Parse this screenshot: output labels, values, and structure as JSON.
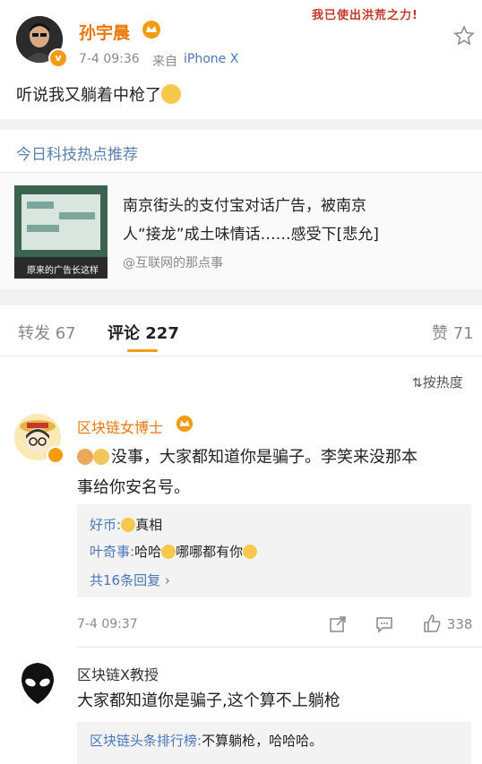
{
  "post": {
    "author": "孙宇晨",
    "time": "7-4 09:36",
    "source_prefix": "来自",
    "source": "iPhone X",
    "text": "听说我又躺着中枪了",
    "sticker_text": "我已使出洪荒之力!"
  },
  "hot_section": {
    "title": "今日科技热点推荐",
    "headline_line1": "南京街头的支付宝对话广告，被南京",
    "headline_line2": "人“接龙”成土味情话……感受下[悲允]",
    "source": "@互联网的那点事",
    "thumb_caption": "原来的广告长这样"
  },
  "tabs": {
    "repost": "转发 67",
    "comments": "评论 227",
    "likes": "赞 71",
    "sort": "按热度"
  },
  "comment1": {
    "author": "区块链女博士",
    "text_line1": "没事，大家都知道你是骗子。李笑来没那本",
    "text_line2": "事给你安名号。",
    "reply1_user": "好币:",
    "reply1_text": "真相",
    "reply2_user": "叶奇事:",
    "reply2_text_a": "哈哈",
    "reply2_text_b": "哪哪都有你",
    "more_replies": "共16条回复",
    "time": "7-4 09:37",
    "like_count": "338"
  },
  "comment2": {
    "author": "区块链X教授",
    "text": "大家都知道你是骗子,这个算不上躺枪",
    "reply_user": "区块链头条排行榜:",
    "reply_text": "不算躺枪，哈哈哈。"
  },
  "colors": {
    "accent_orange": "#e9780a",
    "link_blue": "#4a78b7",
    "background_gray": "#f2f2f2"
  }
}
